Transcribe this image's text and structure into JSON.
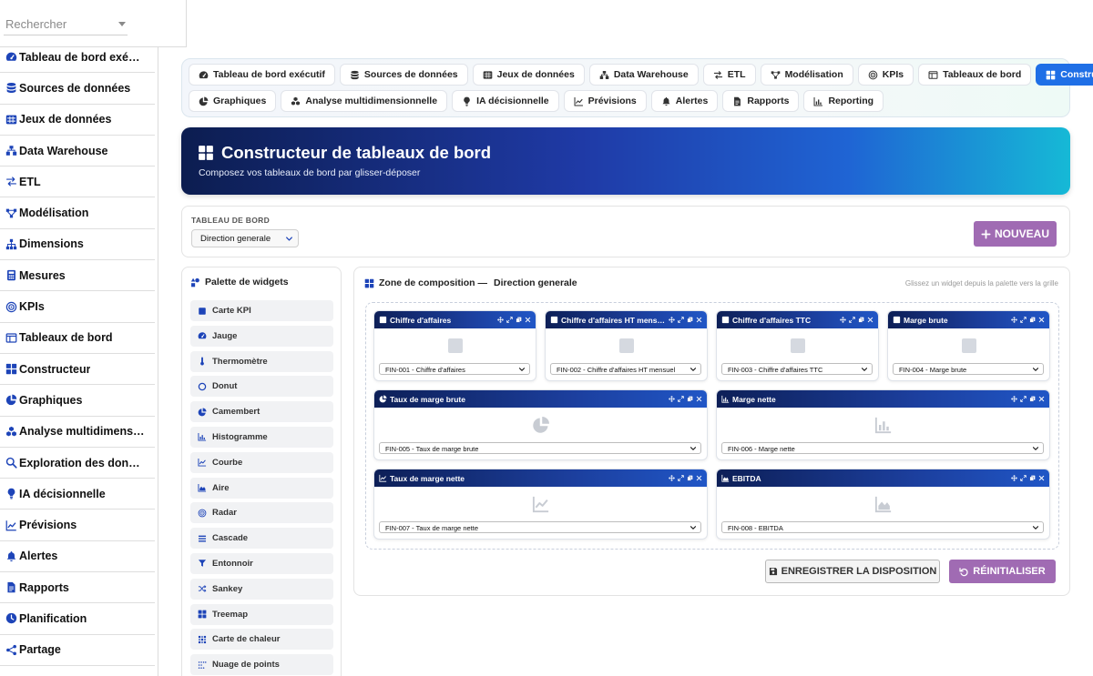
{
  "sidebar": {
    "search_placeholder": "Rechercher",
    "items": [
      {
        "label": "Tableau de bord exé…",
        "icon": "gauge-icon"
      },
      {
        "label": "Sources de données",
        "icon": "database-icon"
      },
      {
        "label": "Jeux de données",
        "icon": "table-icon"
      },
      {
        "label": "Data Warehouse",
        "icon": "warehouse-icon"
      },
      {
        "label": "ETL",
        "icon": "exchange-icon"
      },
      {
        "label": "Modélisation",
        "icon": "diagram-icon"
      },
      {
        "label": "Dimensions",
        "icon": "sitemap-icon"
      },
      {
        "label": "Mesures",
        "icon": "calculator-icon"
      },
      {
        "label": "KPIs",
        "icon": "target-icon"
      },
      {
        "label": "Tableaux de bord",
        "icon": "window-icon"
      },
      {
        "label": "Constructeur",
        "icon": "grid-icon"
      },
      {
        "label": "Graphiques",
        "icon": "pie-chart-icon"
      },
      {
        "label": "Analyse multidimens…",
        "icon": "cubes-icon"
      },
      {
        "label": "Exploration des don…",
        "icon": "search-icon"
      },
      {
        "label": "IA décisionnelle",
        "icon": "lightbulb-icon"
      },
      {
        "label": "Prévisions",
        "icon": "line-chart-icon"
      },
      {
        "label": "Alertes",
        "icon": "bell-icon"
      },
      {
        "label": "Rapports",
        "icon": "file-icon"
      },
      {
        "label": "Planification",
        "icon": "clock-icon"
      },
      {
        "label": "Partage",
        "icon": "share-icon"
      }
    ]
  },
  "tabs": {
    "row1": [
      {
        "label": "Tableau de bord exécutif",
        "icon": "gauge-icon",
        "active": false
      },
      {
        "label": "Sources de données",
        "icon": "database-icon",
        "active": false
      },
      {
        "label": "Jeux de données",
        "icon": "table-icon",
        "active": false
      },
      {
        "label": "Data Warehouse",
        "icon": "warehouse-icon",
        "active": false
      },
      {
        "label": "ETL",
        "icon": "exchange-icon",
        "active": false
      },
      {
        "label": "Modélisation",
        "icon": "diagram-icon",
        "active": false
      },
      {
        "label": "KPIs",
        "icon": "target-icon",
        "active": false
      },
      {
        "label": "Tableaux de bord",
        "icon": "window-icon",
        "active": false
      },
      {
        "label": "Constructeur",
        "icon": "grid-icon",
        "active": true
      }
    ],
    "row2": [
      {
        "label": "Graphiques",
        "icon": "pie-chart-icon",
        "active": false
      },
      {
        "label": "Analyse multidimensionnelle",
        "icon": "cubes-icon",
        "active": false
      },
      {
        "label": "IA décisionnelle",
        "icon": "lightbulb-icon",
        "active": false
      },
      {
        "label": "Prévisions",
        "icon": "line-chart-icon",
        "active": false
      },
      {
        "label": "Alertes",
        "icon": "bell-icon",
        "active": false
      },
      {
        "label": "Rapports",
        "icon": "file-icon",
        "active": false
      },
      {
        "label": "Reporting",
        "icon": "bar-chart-icon",
        "active": false
      }
    ]
  },
  "hero": {
    "title": "Constructeur de tableaux de bord",
    "subtitle": "Composez vos tableaux de bord par glisser-déposer"
  },
  "dashboard_selector": {
    "label": "TABLEAU DE BORD",
    "selected": "Direction generale",
    "new_button": "NOUVEAU"
  },
  "palette": {
    "title": "Palette de widgets",
    "items": [
      {
        "label": "Carte KPI",
        "icon": "square-icon"
      },
      {
        "label": "Jauge",
        "icon": "gauge-icon"
      },
      {
        "label": "Thermomètre",
        "icon": "thermometer-icon"
      },
      {
        "label": "Donut",
        "icon": "circle-icon"
      },
      {
        "label": "Camembert",
        "icon": "pie-chart-icon"
      },
      {
        "label": "Histogramme",
        "icon": "bar-chart-icon"
      },
      {
        "label": "Courbe",
        "icon": "line-chart-icon"
      },
      {
        "label": "Aire",
        "icon": "area-chart-icon"
      },
      {
        "label": "Radar",
        "icon": "radar-icon"
      },
      {
        "label": "Cascade",
        "icon": "bars-icon"
      },
      {
        "label": "Entonnoir",
        "icon": "filter-icon"
      },
      {
        "label": "Sankey",
        "icon": "shuffle-icon"
      },
      {
        "label": "Treemap",
        "icon": "grid-icon"
      },
      {
        "label": "Carte de chaleur",
        "icon": "heatmap-icon"
      },
      {
        "label": "Nuage de points",
        "icon": "scatter-icon"
      }
    ]
  },
  "composition": {
    "title_prefix": "Zone de composition —",
    "dashboard_name": "Direction generale",
    "hint": "Glissez un widget depuis la palette vers la grille",
    "widgets": [
      {
        "title": "Chiffre d'affaires",
        "icon": "square-icon",
        "body_icon": "placeholder-icon",
        "selected": "FIN-001 - Chiffre d'affaires"
      },
      {
        "title": "Chiffre d'affaires HT mens…",
        "icon": "square-icon",
        "body_icon": "placeholder-icon",
        "selected": "FIN-002 - Chiffre d'affaires HT mensuel"
      },
      {
        "title": "Chiffre d'affaires TTC",
        "icon": "square-icon",
        "body_icon": "placeholder-icon",
        "selected": "FIN-003 - Chiffre d'affaires TTC"
      },
      {
        "title": "Marge brute",
        "icon": "square-icon",
        "body_icon": "placeholder-icon",
        "selected": "FIN-004 - Marge brute"
      },
      {
        "title": "Taux de marge brute",
        "icon": "pie-chart-icon",
        "body_icon": "pie-chart-icon",
        "selected": "FIN-005 - Taux de marge brute"
      },
      {
        "title": "Marge nette",
        "icon": "bar-chart-icon",
        "body_icon": "bar-chart-icon",
        "selected": "FIN-006 - Marge nette"
      },
      {
        "title": "Taux de marge nette",
        "icon": "line-chart-icon",
        "body_icon": "line-chart-icon",
        "selected": "FIN-007 - Taux de marge nette"
      },
      {
        "title": "EBITDA",
        "icon": "area-chart-icon",
        "body_icon": "area-chart-icon",
        "selected": "FIN-008 - EBITDA"
      }
    ],
    "save_button": "ENREGISTRER LA DISPOSITION",
    "reset_button": "RÉINITIALISER"
  }
}
